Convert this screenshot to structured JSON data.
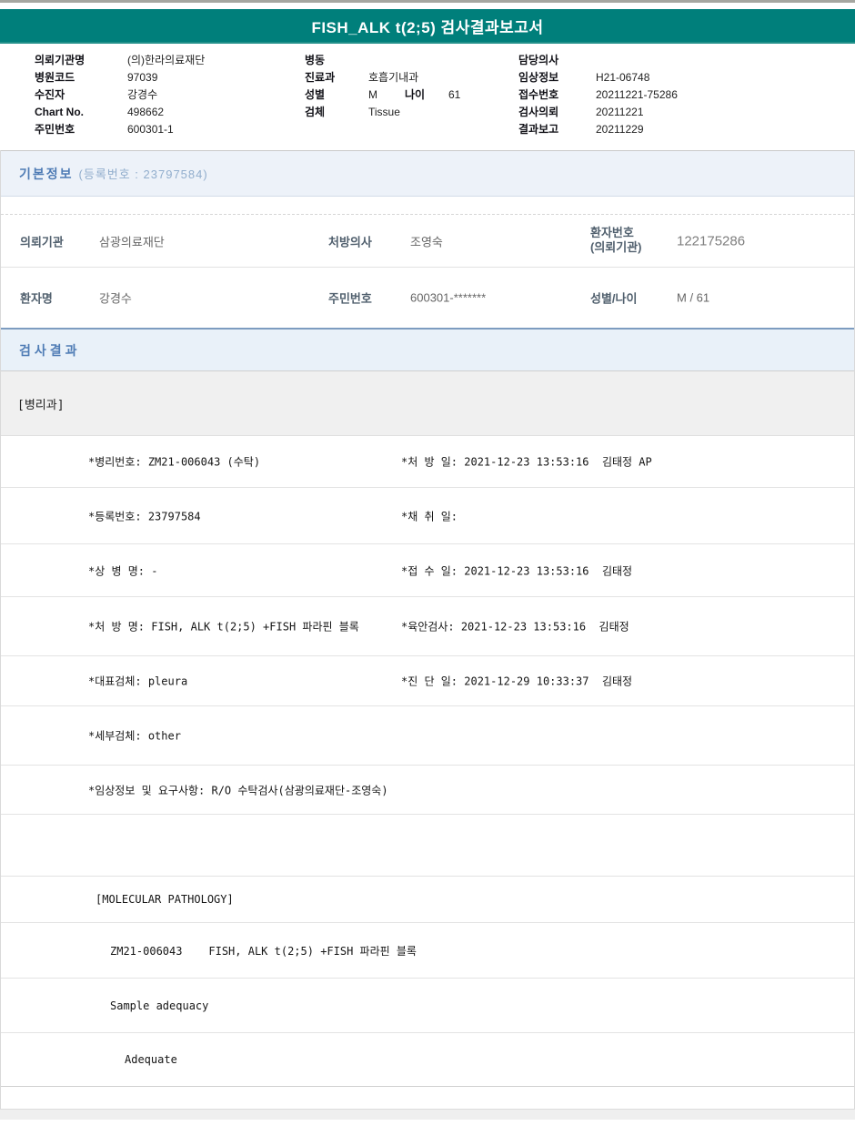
{
  "page": {
    "title": "FISH_ALK t(2;5) 검사결과보고서"
  },
  "colors": {
    "header_teal": "#007f7b",
    "section_bg_blue": "#edf2f9",
    "section_title_blue": "#4f7cb5",
    "divider_steel_blue": "#7d9cc0",
    "department_row_gray": "#f0f0f0"
  },
  "patient_header": {
    "col1": [
      {
        "label": "의뢰기관명",
        "value": "(의)한라의료재단"
      },
      {
        "label": "병원코드",
        "value": "97039"
      },
      {
        "label": "수진자",
        "value": "강경수"
      },
      {
        "label": "Chart No.",
        "value": "498662"
      },
      {
        "label": "주민번호",
        "value": "600301-1"
      }
    ],
    "col2": {
      "ward": {
        "label": "병동",
        "value": ""
      },
      "dept": {
        "label": "진료과",
        "value": "호흡기내과"
      },
      "sex": {
        "label": "성별",
        "value": "M"
      },
      "age": {
        "label": "나이",
        "value": "61"
      },
      "specimen": {
        "label": "검체",
        "value": "Tissue"
      }
    },
    "col3": [
      {
        "label": "담당의사",
        "value": ""
      },
      {
        "label": "임상정보",
        "value": "H21-06748"
      },
      {
        "label": "접수번호",
        "value": "20211221-75286"
      },
      {
        "label": "검사의뢰",
        "value": "20211221"
      },
      {
        "label": "결과보고",
        "value": "20211229"
      }
    ]
  },
  "basic_info": {
    "title": "기본정보",
    "subtitle": "(등록번호 : 23797584)",
    "row1": {
      "c1_label": "의뢰기관",
      "c1_value": "삼광의료재단",
      "c2_label": "처방의사",
      "c2_value": "조영숙",
      "c3_label_line1": "환자번호",
      "c3_label_line2": "(의뢰기관)",
      "c3_value": "122175286"
    },
    "row2": {
      "c1_label": "환자명",
      "c1_value": "강경수",
      "c2_label": "주민번호",
      "c2_value": "600301-*******",
      "c3_label": "성별/나이",
      "c3_value": "M / 61"
    }
  },
  "results": {
    "title": "검사결과",
    "department": "[병리과]",
    "rows": [
      {
        "left": "*병리번호: ZM21-006043 (수탁)",
        "right": "*처 방 일: 2021-12-23 13:53:16  김태정 AP"
      },
      {
        "left": "*등록번호: 23797584",
        "right": "*채 취 일:"
      },
      {
        "left": "*상 병 명: -",
        "right": "*접 수 일: 2021-12-23 13:53:16  김태정"
      },
      {
        "left": "*처 방 명: FISH, ALK t(2;5) +FISH 파라핀 블록",
        "right": "*육안검사: 2021-12-23 13:53:16  김태정"
      },
      {
        "left": "*대표검체: pleura",
        "right": "*진 단 일: 2021-12-29 10:33:37  김태정"
      },
      {
        "left": "*세부검체: other",
        "right": ""
      },
      {
        "left": "*임상정보 및 요구사항: R/O 수탁검사(삼광의료재단-조영숙)",
        "right": ""
      }
    ],
    "molecular": {
      "header": "[MOLECULAR PATHOLOGY]",
      "order_line": "ZM21-006043    FISH, ALK t(2;5) +FISH 파라핀 블록",
      "adequacy_label": "Sample adequacy",
      "adequacy_value": "Adequate"
    }
  }
}
